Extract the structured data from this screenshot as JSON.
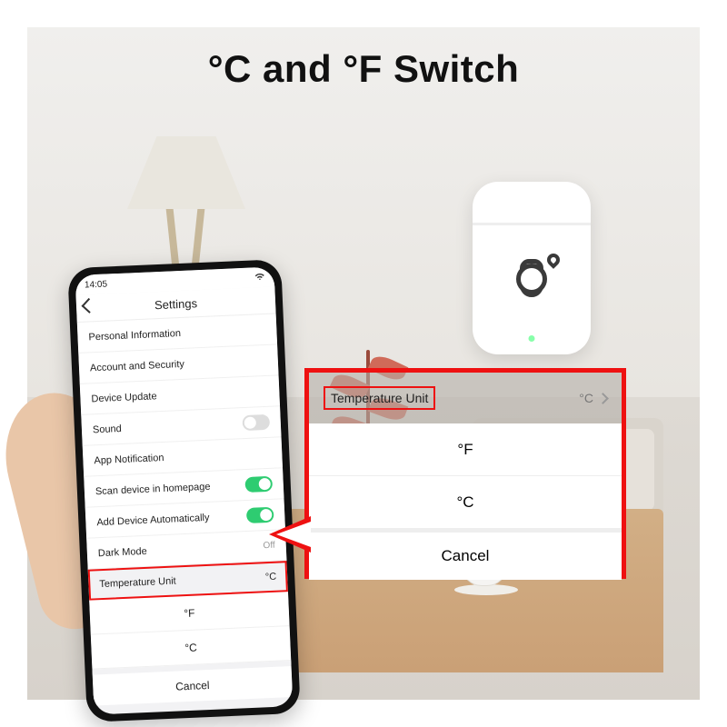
{
  "headline": "°C and °F Switch",
  "phone": {
    "status_time": "14:05",
    "wifi_icon": "wifi",
    "title": "Settings",
    "rows": [
      {
        "label": "Personal Information",
        "type": "plain"
      },
      {
        "label": "Account and Security",
        "type": "plain"
      },
      {
        "label": "Device Update",
        "type": "plain"
      },
      {
        "label": "Sound",
        "type": "toggle",
        "on": false
      },
      {
        "label": "App Notification",
        "type": "plain"
      },
      {
        "label": "Scan device in homepage",
        "type": "toggle",
        "on": true
      },
      {
        "label": "Add Device Automatically",
        "type": "toggle",
        "on": true
      },
      {
        "label": "Dark Mode",
        "type": "value",
        "value": "Off"
      }
    ],
    "temp_unit": {
      "label": "Temperature Unit",
      "value": "°C"
    },
    "sheet": {
      "option_f": "°F",
      "option_c": "°C",
      "cancel": "Cancel"
    }
  },
  "callout": {
    "label": "Temperature Unit",
    "value": "°C",
    "option_f": "°F",
    "option_c": "°C",
    "cancel": "Cancel"
  }
}
